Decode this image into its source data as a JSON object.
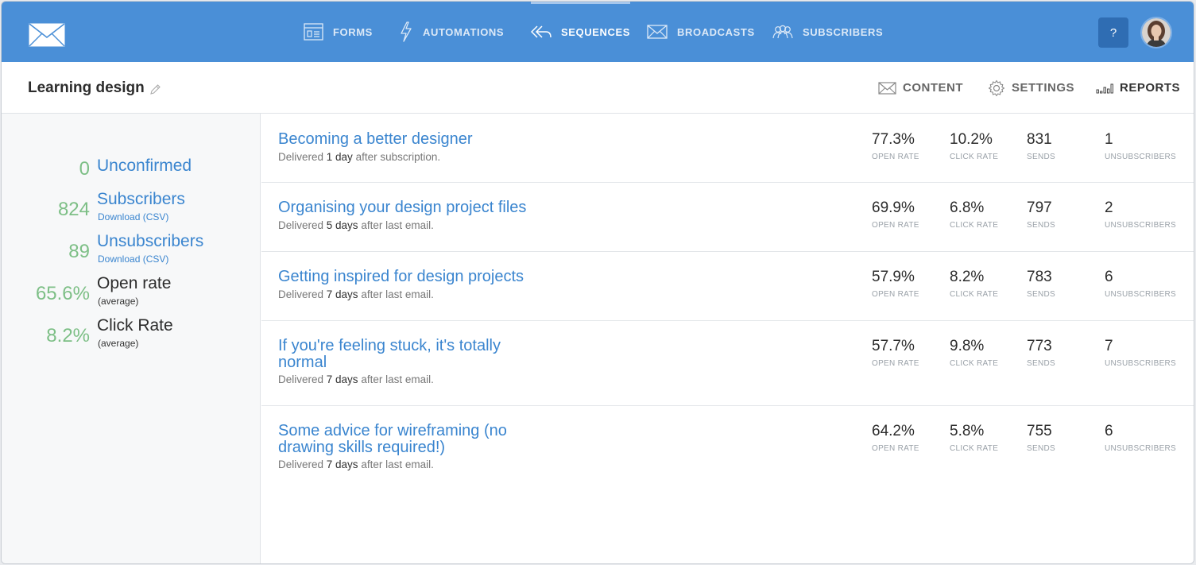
{
  "nav": {
    "items": [
      {
        "label": "FORMS",
        "icon": "forms-icon"
      },
      {
        "label": "AUTOMATIONS",
        "icon": "lightning-icon"
      },
      {
        "label": "SEQUENCES",
        "icon": "sequences-icon"
      },
      {
        "label": "BROADCASTS",
        "icon": "envelope-icon"
      },
      {
        "label": "SUBSCRIBERS",
        "icon": "users-icon"
      }
    ],
    "active": "SEQUENCES",
    "help_label": "?"
  },
  "sequence": {
    "title": "Learning design",
    "tabs": [
      {
        "label": "CONTENT",
        "icon": "envelope-icon"
      },
      {
        "label": "SETTINGS",
        "icon": "gear-icon"
      },
      {
        "label": "REPORTS",
        "icon": "bar-chart-icon"
      }
    ],
    "active_tab": "REPORTS"
  },
  "sidebar": {
    "stats": [
      {
        "value": "0",
        "label": "Unconfirmed",
        "sub": ""
      },
      {
        "value": "824",
        "label": "Subscribers",
        "sub": "Download (CSV)"
      },
      {
        "value": "89",
        "label": "Unsubscribers",
        "sub": "Download (CSV)"
      },
      {
        "value": "65.6%",
        "label": "Open rate",
        "sub": "(average)"
      },
      {
        "value": "8.2%",
        "label": "Click Rate",
        "sub": "(average)"
      }
    ]
  },
  "metric_labels": {
    "open": "OPEN RATE",
    "click": "CLICK RATE",
    "sends": "SENDS",
    "unsub": "UNSUBSCRIBERS"
  },
  "emails": [
    {
      "title": "Becoming a better designer",
      "delay_prefix": "Delivered ",
      "delay": "1 day",
      "delay_suffix": " after subscription.",
      "open": "77.3%",
      "click": "10.2%",
      "sends": "831",
      "unsub": "1"
    },
    {
      "title": "Organising your design project files",
      "delay_prefix": "Delivered ",
      "delay": "5 days",
      "delay_suffix": " after last email.",
      "open": "69.9%",
      "click": "6.8%",
      "sends": "797",
      "unsub": "2"
    },
    {
      "title": "Getting inspired for design projects",
      "delay_prefix": "Delivered ",
      "delay": "7 days",
      "delay_suffix": " after last email.",
      "open": "57.9%",
      "click": "8.2%",
      "sends": "783",
      "unsub": "6"
    },
    {
      "title": "If you're feeling stuck, it's totally normal",
      "delay_prefix": "Delivered ",
      "delay": "7 days",
      "delay_suffix": " after last email.",
      "open": "57.7%",
      "click": "9.8%",
      "sends": "773",
      "unsub": "7"
    },
    {
      "title": "Some advice for wireframing (no drawing skills required!)",
      "delay_prefix": "Delivered ",
      "delay": "7 days",
      "delay_suffix": " after last email.",
      "open": "64.2%",
      "click": "5.8%",
      "sends": "755",
      "unsub": "6"
    }
  ],
  "colors": {
    "topbar": "#4a8fd7",
    "link": "#3a85cf",
    "stat_green": "#7dbf86",
    "help_button": "#2f6db3"
  }
}
